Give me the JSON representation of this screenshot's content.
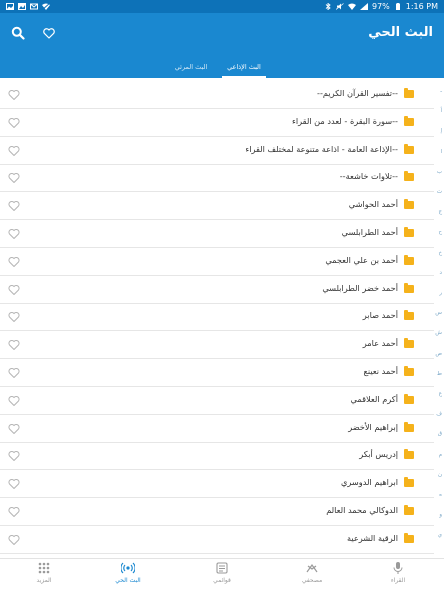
{
  "status_bar": {
    "battery": "97%",
    "time": "1:16 PM"
  },
  "app_bar": {
    "title": "البث الحي"
  },
  "tabs": [
    {
      "label": "البث الإذاعي",
      "active": true
    },
    {
      "label": "البث المرئي",
      "active": false
    }
  ],
  "rows": [
    "--تفسير القرآن الكريم--",
    "--سورة البقرة - لعدد من القراء",
    "--الإذاعة العامة - اذاعة متنوعة لمختلف القراء",
    "--تلاوات خاشعة--",
    "أحمد الحواشي",
    "أحمد الطرابلسي",
    "أحمد بن علي العجمي",
    "أحمد خضر الطرابلسي",
    "أحمد صابر",
    "أحمد عامر",
    "أحمد نعينع",
    "أكرم العلاقمي",
    "إبراهيم الأخضر",
    "إدريس أبكر",
    "ابراهيم الدوسري",
    "الدوكالي محمد العالم",
    "الرقية الشرعية"
  ],
  "index_letters": [
    "ـ",
    "أ",
    "إ",
    "ا",
    "ب",
    "ت",
    "ج",
    "ح",
    "خ",
    "د",
    "ر",
    "س",
    "ش",
    "ص",
    "ط",
    "ع",
    "ف",
    "ق",
    "م",
    "ن",
    "ه",
    "و",
    "ي"
  ],
  "bottom_nav": [
    {
      "label": "المزيد",
      "icon": "grid-icon",
      "active": false
    },
    {
      "label": "البث الحي",
      "icon": "broadcast-icon",
      "active": true
    },
    {
      "label": "قوائمي",
      "icon": "playlist-icon",
      "active": false
    },
    {
      "label": "مصحفي",
      "icon": "quran-icon",
      "active": false
    },
    {
      "label": "القراء",
      "icon": "microphone-icon",
      "active": false
    }
  ],
  "colors": {
    "primary": "#1a88d0",
    "statusbar": "#0d72b8",
    "folder": "#f5b21b"
  }
}
